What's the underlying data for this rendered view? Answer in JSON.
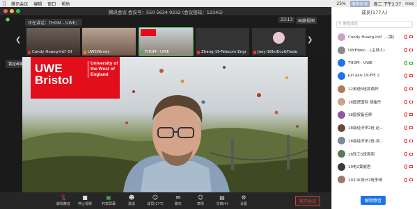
{
  "menubar": {
    "app": "腾讯会议",
    "menus": [
      "编辑",
      "窗口",
      "帮助"
    ],
    "battery": "25%",
    "ime": "搜狗拼音",
    "clock": "周二 下午2:37",
    "user": "mac"
  },
  "window": {
    "title": "腾讯会议 会议号：550 5634 9232 (会议密码：12345)"
  },
  "meeting": {
    "speaking_label": "正在讲话：THOM - UWE；",
    "duration": "23:13",
    "gallery_label": "画廊视图",
    "pin_label": "锁定画面"
  },
  "tiles": [
    {
      "name": "Candy Huang-Intl' Of"
    },
    {
      "name": "UWEWendy"
    },
    {
      "name": "THOM - UWE"
    },
    {
      "name": "Zhang-19-Telecom.Engr"
    },
    {
      "name": "Joey-18IntEco&Trade"
    }
  ],
  "banner": {
    "logo_text": "UWE Bristol",
    "logo_line1": "UWE",
    "logo_line2": "Bristol",
    "university": "University of the West of England"
  },
  "participants": {
    "title": "成员(177人)",
    "search_placeholder": "搜索成员",
    "mute_all": "解除静音",
    "items": [
      {
        "name": "Candy Huang-Intl' ...(我)",
        "color": "#c8a2c8"
      },
      {
        "name": "UWEWen... (主持人)",
        "color": "#8a8a8a"
      },
      {
        "name": "THOM - UWE",
        "color": "#1e73e8"
      },
      {
        "name": "jun jian-19-EIE 2",
        "color": "#1e73e8"
      },
      {
        "name": "12英语5班郭燕妤",
        "color": "#b07a5a"
      },
      {
        "name": "18国贸国际 胡露丹",
        "color": "#c7a48a"
      },
      {
        "name": "18国贸备佳婷",
        "color": "#8e5a9e"
      },
      {
        "name": "18级经济学2班 赵...",
        "color": "#6a4a3a"
      },
      {
        "name": "18级经济学2班-吴...",
        "color": "#7a8a9a"
      },
      {
        "name": "18软工5班周昭",
        "color": "#5a7a5a"
      },
      {
        "name": "19电2黄健君",
        "color": "#3a3a3a"
      },
      {
        "name": "19工业设计2班李琦",
        "color": "#9a7a6a"
      }
    ]
  },
  "toolbar": {
    "buttons": [
      "解除静音",
      "停止视频",
      "共享屏幕",
      "邀请",
      "成员(177)",
      "聊天",
      "表情",
      "文档(4)",
      "设置"
    ],
    "leave": "离开会议"
  }
}
